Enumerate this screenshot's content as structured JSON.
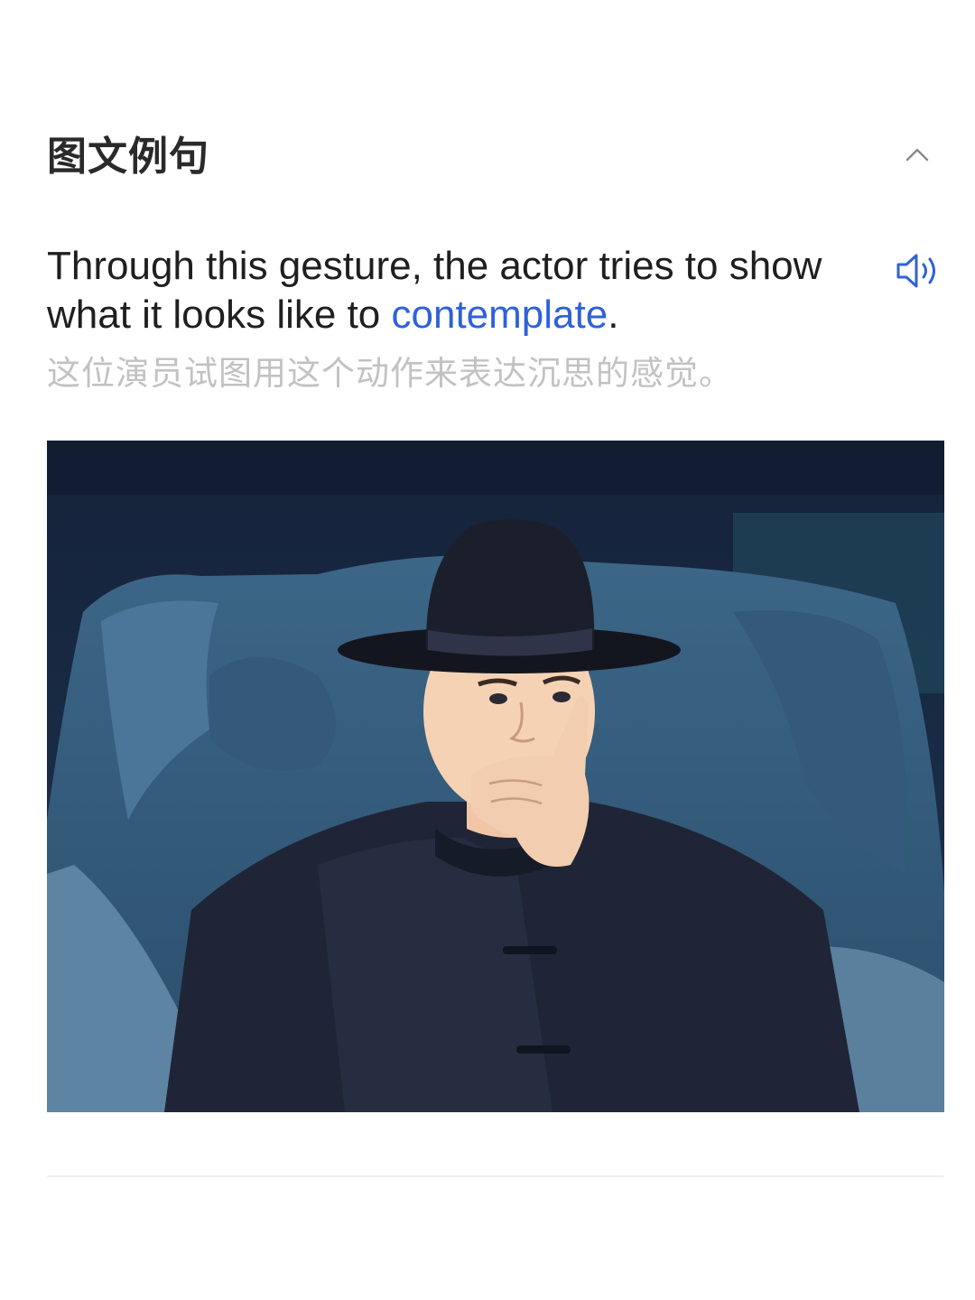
{
  "section": {
    "title": "图文例句",
    "collapse_icon": "chevron-up-icon"
  },
  "example": {
    "sentence_before": "Through this gesture, the actor tries to show what it looks like to ",
    "keyword": "contemplate",
    "sentence_after": ".",
    "translation": "这位演员试图用这个动作来表达沉思的感觉。",
    "speaker_icon": "speaker-icon"
  },
  "colors": {
    "keyword": "#2f62d8",
    "translation": "#c2c2c2",
    "title": "#2a2a2a",
    "icon": "#2f62d8"
  }
}
